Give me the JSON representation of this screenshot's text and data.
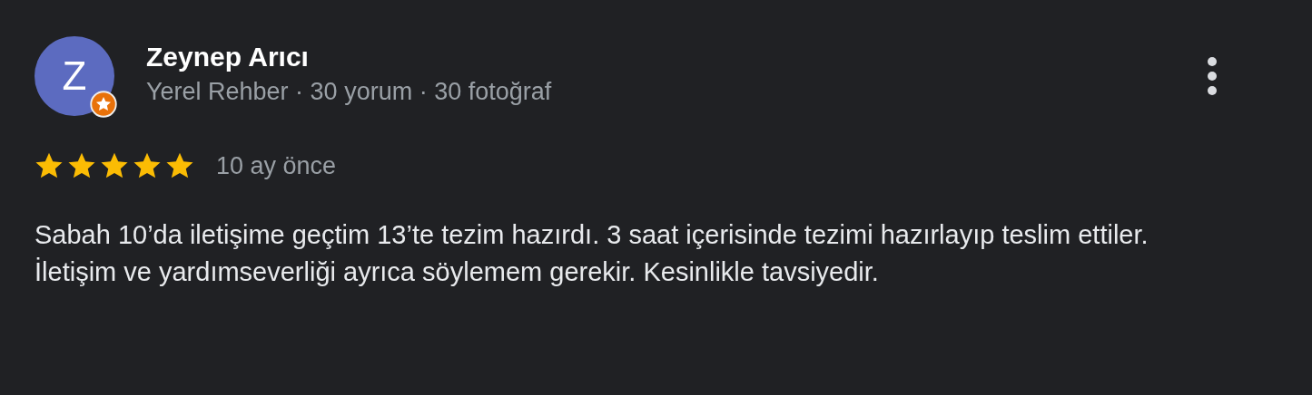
{
  "review": {
    "avatar_letter": "Z",
    "local_guide": true,
    "author": "Zeynep Arıcı",
    "author_meta": "Yerel Rehber · 30 yorum · 30 fotoğraf",
    "stars": 5,
    "time": "10 ay önce",
    "text": "Sabah 10’da iletişime geçtim 13’te tezim hazırdı. 3 saat içerisinde tezimi hazırlayıp teslim ettiler. İletişim ve yardımseverliği ayrıca söylemem gerekir. Kesinlikle tavsiyedir."
  }
}
